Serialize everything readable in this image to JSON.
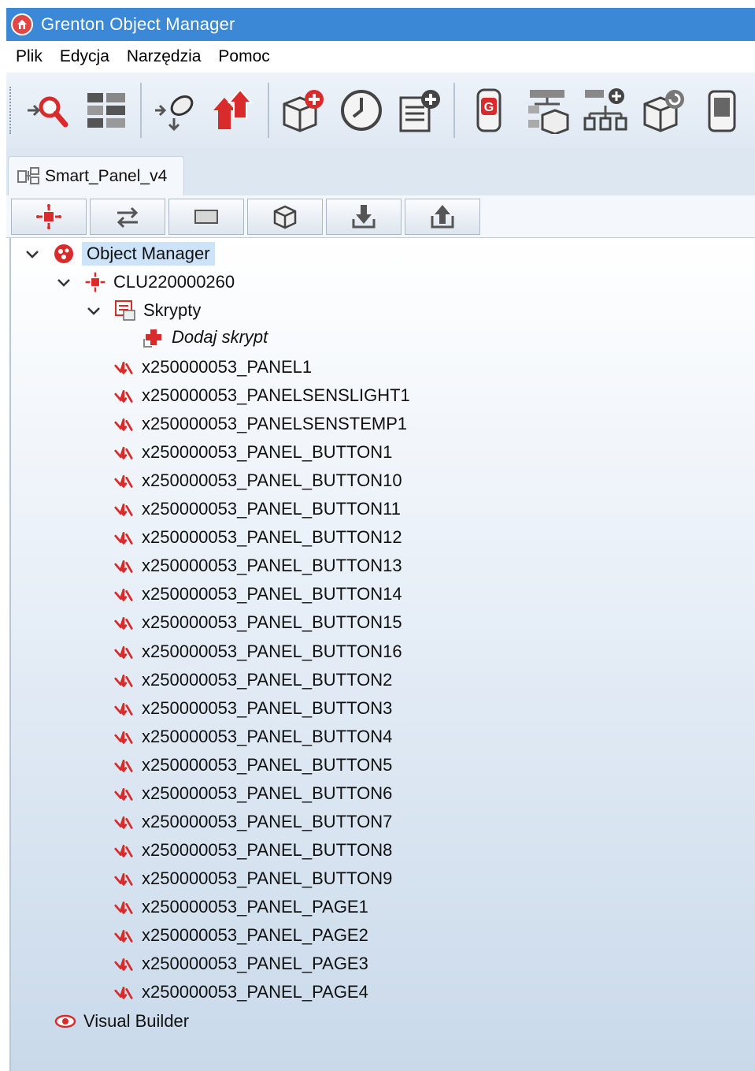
{
  "window": {
    "title": "Grenton Object Manager"
  },
  "menu": [
    "Plik",
    "Edycja",
    "Narzędzia",
    "Pomoc"
  ],
  "toolbar": {
    "buttons": [
      "search-objects-icon",
      "object-grid-icon",
      "send-configuration-icon",
      "upload-icon",
      "add-object-icon",
      "clock-icon",
      "add-document-icon",
      "remote-icon",
      "object-tree-icon",
      "add-hierarchy-icon",
      "refresh-object-icon",
      "device-icon"
    ]
  },
  "tab": {
    "label": "Smart_Panel_v4"
  },
  "panel_toolbar": {
    "buttons": [
      "clu-icon",
      "swap-icon",
      "rectangle-icon",
      "cube-icon",
      "download-icon",
      "upload-house-icon"
    ]
  },
  "tree": {
    "root": {
      "label": "Object Manager"
    },
    "clu": {
      "label": "CLU220000260"
    },
    "scripts": {
      "label": "Skrypty"
    },
    "add_script": {
      "label": "Dodaj skrypt"
    },
    "objects": [
      "x250000053_PANEL1",
      "x250000053_PANELSENSLIGHT1",
      "x250000053_PANELSENSTEMP1",
      "x250000053_PANEL_BUTTON1",
      "x250000053_PANEL_BUTTON10",
      "x250000053_PANEL_BUTTON11",
      "x250000053_PANEL_BUTTON12",
      "x250000053_PANEL_BUTTON13",
      "x250000053_PANEL_BUTTON14",
      "x250000053_PANEL_BUTTON15",
      "x250000053_PANEL_BUTTON16",
      "x250000053_PANEL_BUTTON2",
      "x250000053_PANEL_BUTTON3",
      "x250000053_PANEL_BUTTON4",
      "x250000053_PANEL_BUTTON5",
      "x250000053_PANEL_BUTTON6",
      "x250000053_PANEL_BUTTON7",
      "x250000053_PANEL_BUTTON8",
      "x250000053_PANEL_BUTTON9",
      "x250000053_PANEL_PAGE1",
      "x250000053_PANEL_PAGE2",
      "x250000053_PANEL_PAGE3",
      "x250000053_PANEL_PAGE4"
    ],
    "visual_builder": {
      "label": "Visual Builder"
    }
  },
  "colors": {
    "titlebar": "#3b88d6",
    "accent_red": "#e03a3a",
    "selection": "#cde3f9"
  }
}
